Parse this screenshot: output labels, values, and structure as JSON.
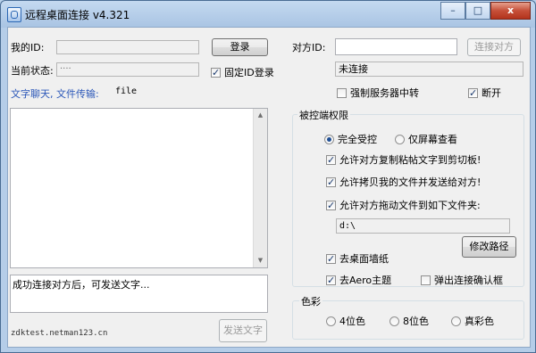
{
  "window": {
    "title": "远程桌面连接 v4.321"
  },
  "caption_buttons": {
    "minimize": "–",
    "maximize": "□",
    "close": "x"
  },
  "left": {
    "my_id_label": "我的ID:",
    "my_id_value": "",
    "login_button": "登录",
    "status_label": "当前状态:",
    "status_value": "····",
    "fixed_id_label": "固定ID登录",
    "fixed_id_checked": true,
    "chat_label": "文字聊天, 文件传输:",
    "file_label": "file",
    "message_placeholder": "成功连接对方后，可发送文字...",
    "website": "zdktest.netman123.cn",
    "send_button": "发送文字"
  },
  "right": {
    "peer_id_label": "对方ID:",
    "peer_id_value": "",
    "connect_button": "连接对方",
    "conn_status": "未连接",
    "force_relay_label": "强制服务器中转",
    "force_relay_checked": false,
    "disconnect_label": "断开",
    "disconnect_checked": true,
    "permissions": {
      "title": "被控端权限",
      "full_control": "完全受控",
      "screen_only": "仅屏幕查看",
      "selected": "full_control",
      "allow_clipboard": "允许对方复制粘帖文字到剪切板!",
      "allow_copy_files": "允许拷贝我的文件并发送给对方!",
      "allow_drag_files": "允许对方拖动文件到如下文件夹:",
      "folder_path": "d:\\",
      "modify_path_button": "修改路径",
      "remove_wallpaper": "去桌面墙纸",
      "remove_aero": "去Aero主题",
      "popup_confirm": "弹出连接确认框",
      "checks": {
        "allow_clipboard": true,
        "allow_copy_files": true,
        "allow_drag_files": true,
        "remove_wallpaper": true,
        "remove_aero": true,
        "popup_confirm": false
      }
    },
    "color": {
      "title": "色彩",
      "options": [
        "4位色",
        "8位色",
        "真彩色"
      ],
      "selected": null
    }
  }
}
